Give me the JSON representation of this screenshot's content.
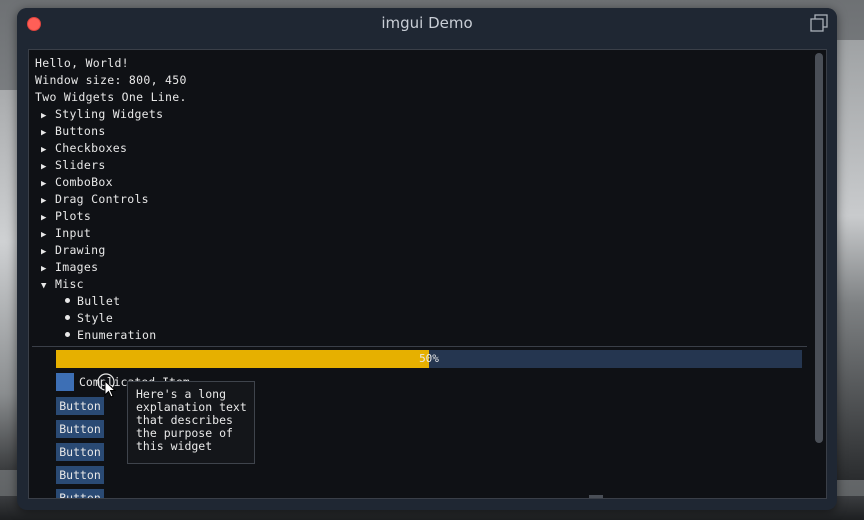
{
  "window": {
    "title": "imgui Demo"
  },
  "content": {
    "text_lines": [
      "Hello, World!",
      "Window size: 800, 450",
      "Two Widgets One Line."
    ],
    "tree_nodes": [
      {
        "label": "Styling Widgets",
        "expanded": false
      },
      {
        "label": "Buttons",
        "expanded": false
      },
      {
        "label": "Checkboxes",
        "expanded": false
      },
      {
        "label": "Sliders",
        "expanded": false
      },
      {
        "label": "ComboBox",
        "expanded": false
      },
      {
        "label": "Drag Controls",
        "expanded": false
      },
      {
        "label": "Plots",
        "expanded": false
      },
      {
        "label": "Input",
        "expanded": false
      },
      {
        "label": "Drawing",
        "expanded": false
      },
      {
        "label": "Images",
        "expanded": false
      },
      {
        "label": "Misc",
        "expanded": true
      }
    ],
    "bullets": [
      "Bullet",
      "Style",
      "Enumeration"
    ],
    "progress": {
      "value": 0.5,
      "label": "50%"
    },
    "complicated_item_label": "Complicated Item",
    "buttons": [
      "Button",
      "Button",
      "Button",
      "Button",
      "Button"
    ],
    "tooltip": "Here's a long\nexplanation text\nthat describes\nthe purpose of\nthis widget"
  },
  "colors": {
    "progress_fill": "#e6b000",
    "progress_bg": "#253650",
    "button_bg": "#2a4a74",
    "color_square": "#3d6fb5",
    "close_button": "#ff5f57"
  }
}
